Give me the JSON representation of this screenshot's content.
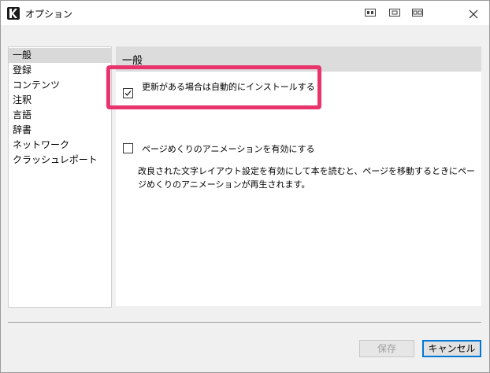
{
  "window": {
    "title": "オプション"
  },
  "sidebar": {
    "items": [
      {
        "label": "一般",
        "selected": true
      },
      {
        "label": "登録"
      },
      {
        "label": "コンテンツ"
      },
      {
        "label": "注釈"
      },
      {
        "label": "言語"
      },
      {
        "label": "辞書"
      },
      {
        "label": "ネットワーク"
      },
      {
        "label": "クラッシュレポート"
      }
    ]
  },
  "main": {
    "section_title": "一般",
    "options": [
      {
        "label": "更新がある場合は自動的にインストールする",
        "checked": true
      },
      {
        "label": "ページめくりのアニメーションを有効にする",
        "checked": false
      }
    ],
    "description_line1": "改良された文字レイアウト設定を有効にして本を読むと、ページを移動するときにペー",
    "description_line2": "ジめくりのアニメーションが再生されます。"
  },
  "buttons": {
    "save": "保存",
    "cancel": "キャンセル"
  },
  "colors": {
    "highlight": "#e8336b",
    "accent": "#0078d7"
  }
}
